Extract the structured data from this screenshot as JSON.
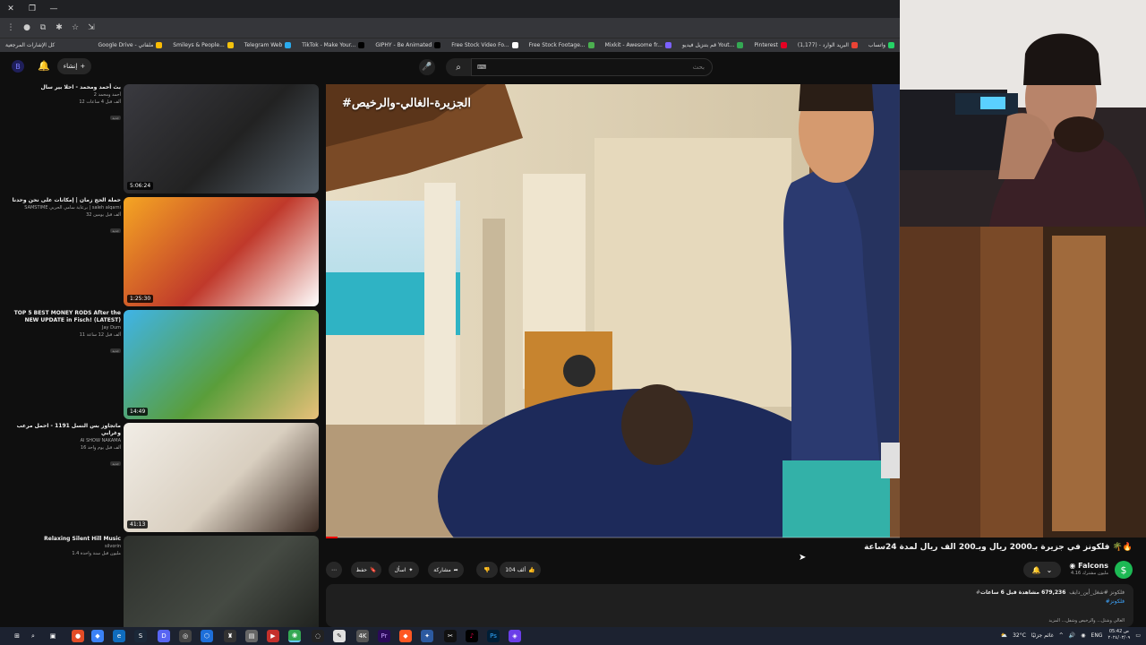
{
  "browser": {
    "bookmarks": [
      {
        "label": "واتساب",
        "color": "#25d366"
      },
      {
        "label": "البريد الوارد - (1,177)",
        "color": "#ea4335"
      },
      {
        "label": "Pinterest",
        "color": "#e60023"
      },
      {
        "label": "قم بتنزيل فيديو Yout...",
        "color": "#34a853"
      },
      {
        "label": "Mixkit - Awesome fr...",
        "color": "#7b61ff"
      },
      {
        "label": "Free Stock Footage...",
        "color": "#4caf50"
      },
      {
        "label": "Free Stock Video Fo...",
        "color": "#ffffff"
      },
      {
        "label": "GIPHY - Be Animated",
        "color": "#000000"
      },
      {
        "label": "TikTok - Make Your...",
        "color": "#000000"
      },
      {
        "label": "Telegram Web",
        "color": "#2aabee"
      },
      {
        "label": "Smileys & People...",
        "color": "#f4c20d"
      },
      {
        "label": "Google Drive - ملفاتي",
        "color": "#fbbc04"
      }
    ],
    "all_bookmarks": "كل الإشارات المرجعية"
  },
  "header": {
    "create_label": "إنشاء",
    "search_placeholder": "بحث"
  },
  "recommendations": [
    {
      "title": "بث أحمد ومحمد - احلا بير سال",
      "channel": "أحمد ومحمد 2",
      "stats": "12 ألف قبل 4 ساعات",
      "badge": "جديد",
      "duration": "5:06:24",
      "colors": [
        "#3a3a40",
        "#222",
        "#55606a"
      ]
    },
    {
      "title": "حملة الحج زمان | إمكانات على نحن وحدنا",
      "channel": "SAMSTIME برعاية سامي الحربي | saleh alqarni",
      "stats": "32 ألف قبل يومين",
      "badge": "جديد",
      "duration": "1:25:30",
      "colors": [
        "#f5a623",
        "#c0392b",
        "#fff"
      ]
    },
    {
      "title": "TOP 5 BEST MONEY RODS After the NEW UPDATE in Fisch! (LATEST)",
      "channel": "Jay Dum",
      "stats": "11 ألف قبل 12 ساعة",
      "badge": "جديد",
      "duration": "14:49",
      "colors": [
        "#3fb4e8",
        "#5a9e3a",
        "#e8c07a"
      ]
    },
    {
      "title": "ماتجاوز بس النسل 1191 - احمل مرعب وغرابي",
      "channel": "AI SHOW NAKAMA",
      "stats": "16 ألف قبل يوم واحد",
      "badge": "جديد",
      "duration": "41:13",
      "colors": [
        "#f1ede6",
        "#d9cfc0",
        "#3b2a22"
      ]
    },
    {
      "title": "Relaxing Silent Hill Music",
      "channel": "silvorin",
      "stats": "1.4 مليون قبل سنة واحدة",
      "badge": "",
      "duration": "",
      "colors": [
        "#2d302c",
        "#454a43",
        "#1b1d1a"
      ]
    }
  ],
  "player": {
    "overlay_title": "#الجزيرة-الغالي-والرخيص",
    "progress_fraction": 0.02
  },
  "video": {
    "title": "فلكونز في جزيرة بـ2000 ريال وبـ200 الف ريال لمدة 24ساعة 🌴🔥",
    "channel_name": "Falcons",
    "channel_subs": "4.16 مليون مشترك",
    "likes": "104 ألف",
    "share_label": "مشاركة",
    "ask_label": "اسأل",
    "save_label": "حفظ",
    "views": "679,236 مشاهدة قبل 6 ساعات",
    "tags": "#فلكونز #شغل_أين_دايف",
    "hashtag": "#فلكونز",
    "more": "الغالي وشتل... والرخيص وشفل... المزيد"
  },
  "taskbar": {
    "weather": "32°C",
    "weather_desc": "غائم جزئيًا",
    "lang": "ENG",
    "time": "05:42 ص",
    "date": "٢٠٢٤/٠٣/٠٩"
  }
}
